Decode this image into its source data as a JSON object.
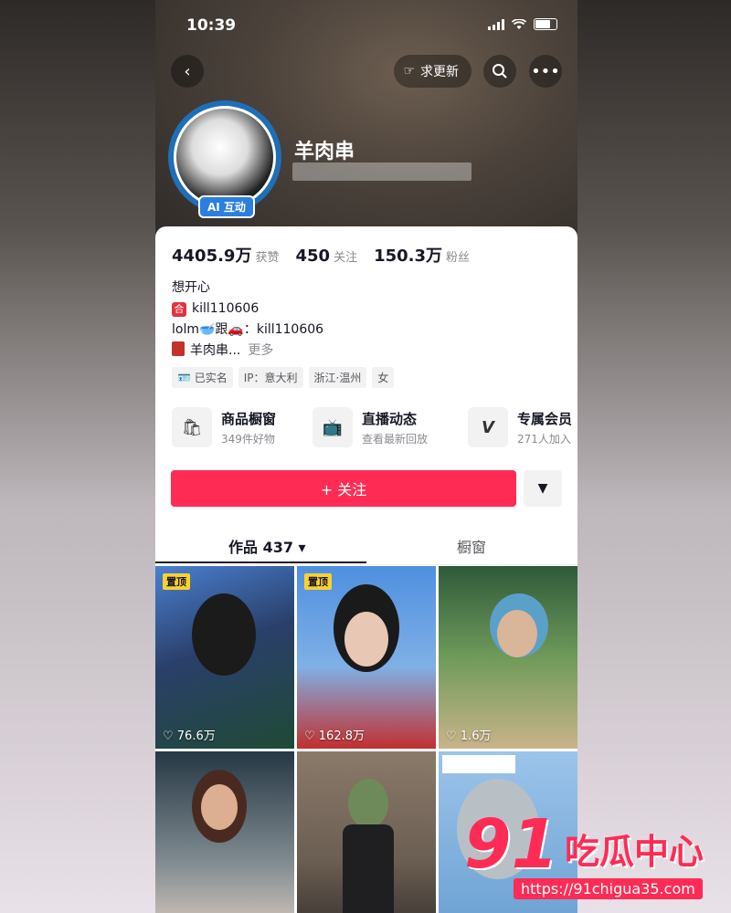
{
  "status": {
    "time": "10:39"
  },
  "nav": {
    "request_update": "求更新"
  },
  "profile": {
    "name": "羊肉串",
    "ai_badge": "AI 互动",
    "stats": [
      {
        "value": "4405.9万",
        "label": "获赞"
      },
      {
        "value": "450",
        "label": "关注"
      },
      {
        "value": "150.3万",
        "label": "粉丝"
      }
    ],
    "bio": {
      "line1": "想开心",
      "line2_mark": "合",
      "line2": "kill110606",
      "line3": "lolm🥣跟🚗：kill110606",
      "line4": "羊肉串...",
      "more": "更多"
    },
    "tags": [
      "🪪 已实名",
      "IP：意大利",
      "浙江·温州",
      "女"
    ]
  },
  "services": [
    {
      "title": "商品橱窗",
      "sub": "349件好物",
      "icon": "shopping-bag-icon"
    },
    {
      "title": "直播动态",
      "sub": "查看最新回放",
      "icon": "tv-icon"
    },
    {
      "title": "专属会员",
      "sub": "271人加入",
      "icon": "v-icon"
    }
  ],
  "actions": {
    "follow": "+ 关注",
    "dropdown": "▼"
  },
  "tabs": {
    "works": "作品 437 ▾",
    "shop": "橱窗"
  },
  "grid": [
    {
      "pinned": "置顶",
      "likes": "♡ 76.6万"
    },
    {
      "pinned": "置顶",
      "likes": "♡ 162.8万"
    },
    {
      "pinned": "",
      "likes": "♡ 1.6万"
    },
    {
      "pinned": "",
      "likes": ""
    },
    {
      "pinned": "",
      "likes": ""
    },
    {
      "pinned": "",
      "likes": ""
    }
  ],
  "watermark": {
    "num": "91",
    "text": "吃瓜中心",
    "url": "https://91chigua35.com"
  },
  "colors": {
    "accent": "#fe2c55",
    "pin": "#fcd02e",
    "ai_badge": "#2b7fe0"
  }
}
